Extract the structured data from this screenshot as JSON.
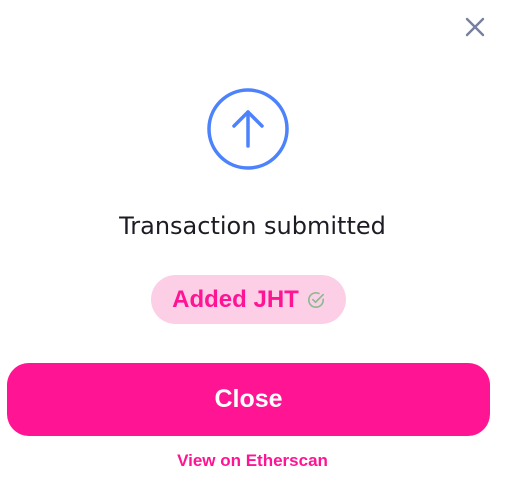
{
  "modal": {
    "close_icon": "close-icon",
    "status_icon": "arrow-up-circle-icon",
    "title": "Transaction submitted",
    "badge": {
      "label": "Added JHT",
      "icon": "check-circle-icon"
    },
    "close_button_label": "Close",
    "explorer_link_label": "View on Etherscan"
  },
  "colors": {
    "accent": "#ff1493",
    "badge_bg": "#fccfe7",
    "status_icon": "#4c82fb",
    "close_icon": "#7780a0",
    "check_icon": "#8ab98f",
    "text": "#1c1c24"
  }
}
